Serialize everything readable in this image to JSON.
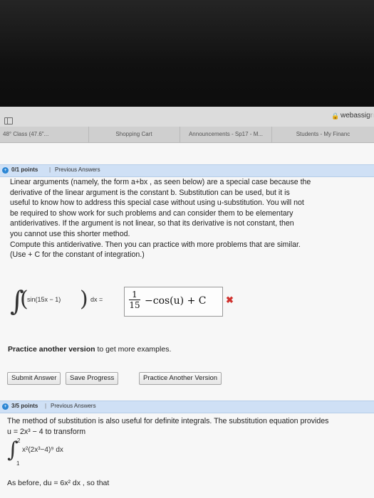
{
  "browser": {
    "url": "webassign",
    "tabs": [
      {
        "label": "48° Class (47.6\"..."
      },
      {
        "label": "Shopping Cart"
      },
      {
        "label": "Announcements - Sp17 - M..."
      },
      {
        "label": "Students - My Financ"
      }
    ]
  },
  "question1": {
    "points": "0/1 points",
    "separator": "|",
    "previous_answers": "Previous Answers",
    "text_lines": [
      "Linear arguments (namely, the form a+bx , as seen below) are a special case because the",
      "derivative of the linear argument is the constant b. Substitution can be used, but it is",
      "useful to know how to address this special case without using u-substitution. You will not",
      "be required to show work for such problems and can consider them to be elementary",
      "antiderivatives. If the argument is not linear, so that its derivative is not constant, then",
      "you cannot use this shorter method.",
      "Compute this antiderivative. Then you can practice with more problems that are similar.",
      "(Use + C for the constant of integration.)"
    ],
    "integral_symbol": "∫",
    "integrand": "sin(15x − 1)",
    "dx_equals": "dx =",
    "answer_numerator": "1",
    "answer_denominator": "15",
    "answer_rest": "−cos(u) + C",
    "wrong_mark": "✖",
    "practice_bold": "Practice another version",
    "practice_rest": " to get more examples.",
    "buttons": {
      "submit": "Submit Answer",
      "save": "Save Progress",
      "practice": "Practice Another Version"
    }
  },
  "question2": {
    "points": "3/5 points",
    "separator": "|",
    "previous_answers": "Previous Answers",
    "text_line1": "The method of substitution is also useful for definite integrals. The substitution equation provides",
    "text_line2": "u = 2x³ − 4  to transform",
    "upper_limit": "2",
    "lower_limit": "1",
    "integral_expr": "x²(2x³−4)⁹ dx",
    "bottom_text": "As before,  du = 6x² dx , so that"
  }
}
